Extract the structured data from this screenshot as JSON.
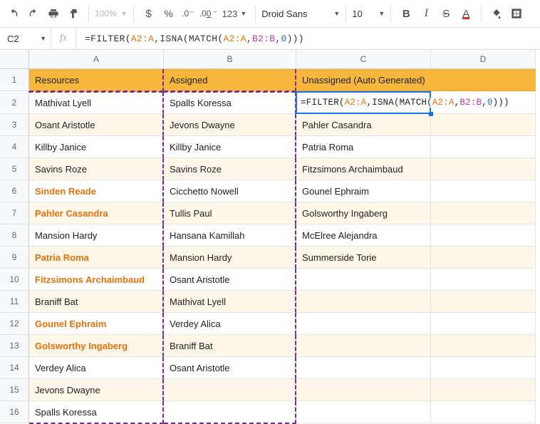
{
  "toolbar": {
    "zoom": "100%",
    "font": "Droid Sans",
    "size": "10",
    "currency": "$",
    "percent": "%",
    "dec_dec": ".0",
    "dec_inc": ".00",
    "numfmt": "123",
    "bold": "B",
    "italic": "I",
    "strike": "S",
    "textcolor": "A"
  },
  "namebox": "C2",
  "formula": {
    "prefix": "=FILTER(",
    "r1a": "A2:A",
    "c1": ",ISNA(MATCH(",
    "r1b": "A2:A",
    "c2": ",",
    "r2": "B2:B",
    "c3": ",",
    "n": "0",
    "suffix": ")))"
  },
  "columns": [
    "A",
    "B",
    "C",
    "D"
  ],
  "headers": {
    "a": "Resources",
    "b": "Assigned",
    "c": "Unassigned (Auto Generated)"
  },
  "rows": [
    {
      "n": "2",
      "a": "Mathivat Lyell",
      "b": "Spalls Koressa",
      "c": "",
      "ao": false,
      "band": false
    },
    {
      "n": "3",
      "a": "Osant Aristotle",
      "b": "Jevons Dwayne",
      "c": "Pahler Casandra",
      "ao": false,
      "band": true
    },
    {
      "n": "4",
      "a": "Killby Janice",
      "b": "Killby Janice",
      "c": "Patria Roma",
      "ao": false,
      "band": false
    },
    {
      "n": "5",
      "a": "Savins Roze",
      "b": "Savins Roze",
      "c": "Fitzsimons Archaimbaud",
      "ao": false,
      "band": true
    },
    {
      "n": "6",
      "a": "Sinden Reade",
      "b": "Cicchetto Nowell",
      "c": "Gounel Ephraim",
      "ao": true,
      "band": false
    },
    {
      "n": "7",
      "a": "Pahler Casandra",
      "b": "Tullis Paul",
      "c": "Golsworthy Ingaberg",
      "ao": true,
      "band": true
    },
    {
      "n": "8",
      "a": "Mansion Hardy",
      "b": "Hansana Kamillah",
      "c": "McElree Alejandra",
      "ao": false,
      "band": false
    },
    {
      "n": "9",
      "a": "Patria Roma",
      "b": "Mansion Hardy",
      "c": "Summerside Torie",
      "ao": true,
      "band": true
    },
    {
      "n": "10",
      "a": "Fitzsimons Archaimbaud",
      "b": "Osant Aristotle",
      "c": "",
      "ao": true,
      "band": false
    },
    {
      "n": "11",
      "a": "Braniff Bat",
      "b": "Mathivat Lyell",
      "c": "",
      "ao": false,
      "band": true
    },
    {
      "n": "12",
      "a": "Gounel Ephraim",
      "b": "Verdey Alica",
      "c": "",
      "ao": true,
      "band": false
    },
    {
      "n": "13",
      "a": "Golsworthy Ingaberg",
      "b": "Braniff Bat",
      "c": "",
      "ao": true,
      "band": true
    },
    {
      "n": "14",
      "a": "Verdey Alica",
      "b": "Osant Aristotle",
      "c": "",
      "ao": false,
      "band": false
    },
    {
      "n": "15",
      "a": "Jevons Dwayne",
      "b": "",
      "c": "",
      "ao": false,
      "band": true
    },
    {
      "n": "16",
      "a": "Spalls Koressa",
      "b": "",
      "c": "",
      "ao": false,
      "band": false
    }
  ]
}
